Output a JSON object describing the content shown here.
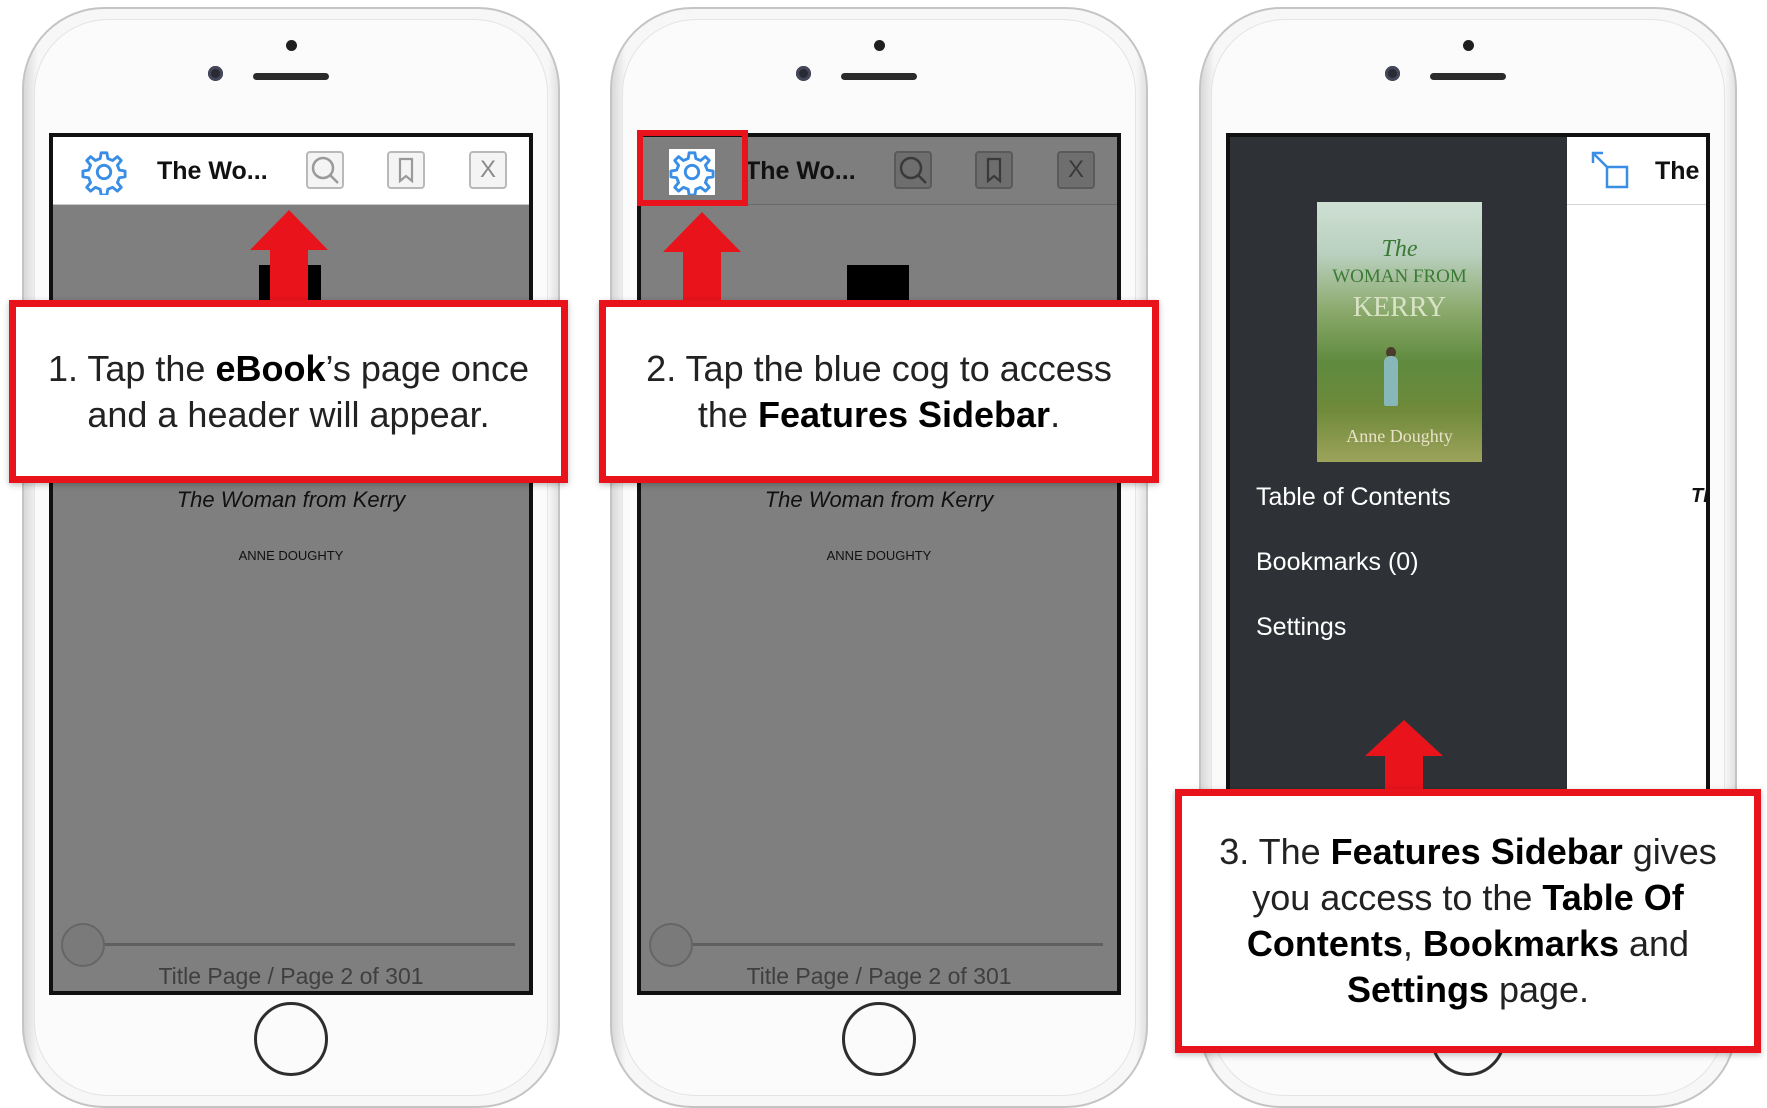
{
  "colors": {
    "accent_red": "#e9141b",
    "cog_blue": "#3a8ee6",
    "sidebar_bg": "#2e3236",
    "page_gray": "#7f7f7f"
  },
  "step1": {
    "header": {
      "title": "The Wo...",
      "settings_icon": "cog-icon",
      "search_icon": "search-icon",
      "bookmark_icon": "bookmark-icon",
      "close_label": "X"
    },
    "book": {
      "title": "The Woman from Kerry",
      "author": "ANNE DOUGHTY"
    },
    "footer": {
      "page_indicator": "Title Page / Page 2 of 301",
      "progress": 0.0
    },
    "callout": {
      "prefix": "1. Tap the ",
      "bold": "eBook",
      "suffix_line1": "’s page once",
      "line2": "and a header will appear."
    }
  },
  "step2": {
    "header": {
      "title": "The Wo...",
      "settings_icon": "cog-icon",
      "search_icon": "search-icon",
      "bookmark_icon": "bookmark-icon",
      "close_label": "X"
    },
    "book": {
      "title": "The Woman from Kerry",
      "author": "ANNE DOUGHTY"
    },
    "footer": {
      "page_indicator": "Title Page / Page 2 of 301",
      "progress": 0.0
    },
    "callout": {
      "line1": "2. Tap the blue cog to access",
      "line2_prefix": "the ",
      "bold": "Features Sidebar",
      "line2_suffix": "."
    }
  },
  "step3": {
    "cover": {
      "word1": "The",
      "word2": "WOMAN FROM",
      "word3": "KERRY",
      "author": "Anne Doughty"
    },
    "sidebar_items": [
      "Table of Contents",
      "Bookmarks (0)",
      "Settings"
    ],
    "content_header": {
      "title": "The W",
      "expand_icon": "expand-icon"
    },
    "content_peek": "Th",
    "callout": {
      "p1": "3. The ",
      "b1": "Features Sidebar",
      "p2": " gives you access to the ",
      "b2": "Table Of Contents",
      "p3": ", ",
      "b3": "Bookmarks",
      "p4": " and ",
      "b4": "Settings",
      "p5": " page."
    }
  }
}
